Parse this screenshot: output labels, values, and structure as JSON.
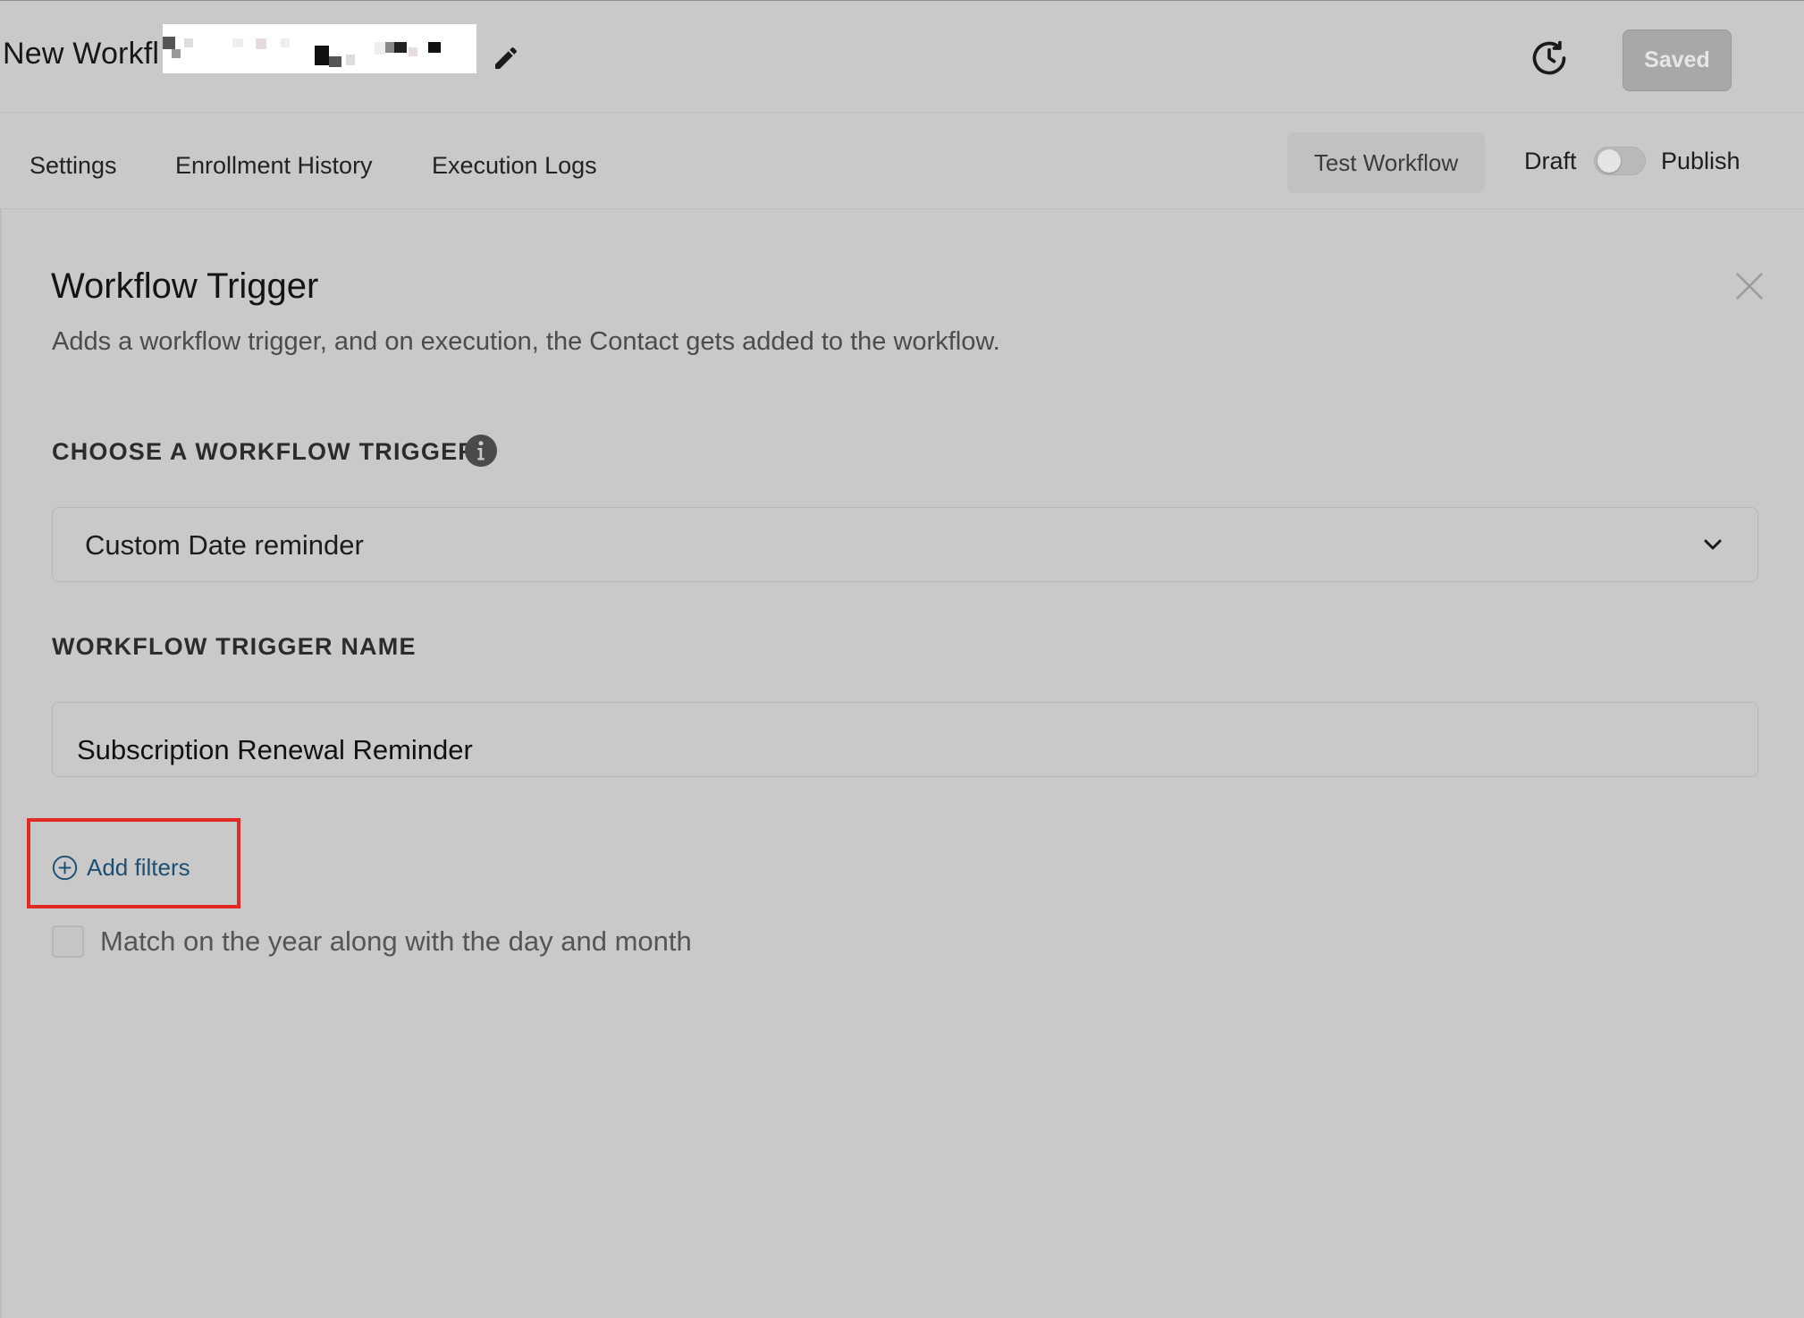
{
  "header": {
    "title": "New Workfl",
    "saved_label": "Saved"
  },
  "nav": {
    "tabs": [
      {
        "label": "Settings"
      },
      {
        "label": "Enrollment History"
      },
      {
        "label": "Execution Logs"
      }
    ],
    "test_workflow_label": "Test Workflow",
    "draft_label": "Draft",
    "publish_label": "Publish",
    "publish_enabled": false
  },
  "panel": {
    "title": "Workflow Trigger",
    "description": "Adds a workflow trigger, and on execution, the Contact gets added to the workflow.",
    "trigger_section_label": "CHOOSE A WORKFLOW TRIGGER",
    "trigger_selected": "Custom Date reminder",
    "name_section_label": "WORKFLOW TRIGGER NAME",
    "name_value": "Subscription Renewal Reminder",
    "add_filters_label": "Add filters",
    "match_year_label": "Match on the year along with the day and month",
    "match_year_checked": false
  },
  "colors": {
    "background": "#c9c9c9",
    "link": "#1d4f73",
    "highlight_border": "#e12a24",
    "saved_button": "#a8a8a8"
  },
  "icons": {
    "edit": "pencil-icon",
    "history": "history-clock-icon",
    "close": "close-icon",
    "info": "info-icon",
    "dropdown": "chevron-down-icon",
    "add": "plus-circle-icon"
  }
}
